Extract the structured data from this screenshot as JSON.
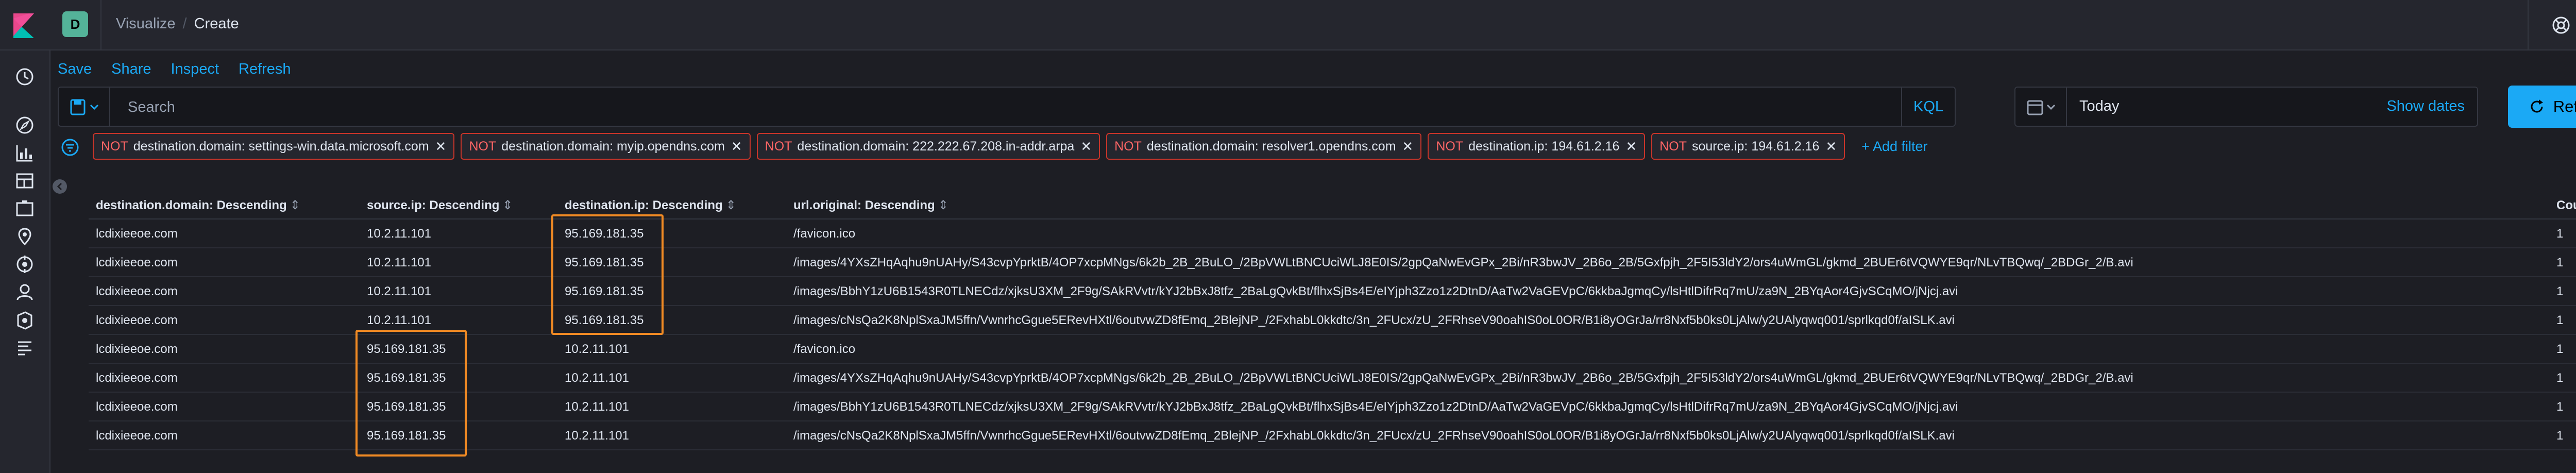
{
  "header": {
    "space_initial": "D",
    "breadcrumbs": [
      "Visualize",
      "Create"
    ]
  },
  "toolbar": {
    "save_label": "Save",
    "share_label": "Share",
    "inspect_label": "Inspect",
    "refresh_label": "Refresh"
  },
  "search": {
    "placeholder": "Search",
    "language_label": "KQL"
  },
  "time": {
    "value": "Today",
    "show_dates_label": "Show dates",
    "refresh_button_label": "Refresh"
  },
  "filters": {
    "items": [
      {
        "prefix": "NOT",
        "text": "destination.domain: settings-win.data.microsoft.com"
      },
      {
        "prefix": "NOT",
        "text": "destination.domain: myip.opendns.com"
      },
      {
        "prefix": "NOT",
        "text": "destination.domain: 222.222.67.208.in-addr.arpa"
      },
      {
        "prefix": "NOT",
        "text": "destination.domain: resolver1.opendns.com"
      },
      {
        "prefix": "NOT",
        "text": "destination.ip: 194.61.2.16"
      },
      {
        "prefix": "NOT",
        "text": "source.ip: 194.61.2.16"
      }
    ],
    "add_filter_label": "+ Add filter"
  },
  "table": {
    "columns": [
      "destination.domain: Descending",
      "source.ip: Descending",
      "destination.ip: Descending",
      "url.original: Descending",
      "Count"
    ],
    "rows": [
      [
        "lcdixieeoe.com",
        "10.2.11.101",
        "95.169.181.35",
        "/favicon.ico",
        "1"
      ],
      [
        "lcdixieeoe.com",
        "10.2.11.101",
        "95.169.181.35",
        "/images/4YXsZHqAqhu9nUAHy/S43cvpYprktB/4OP7xcpMNgs/6k2b_2B_2BuLO_/2BpVWLtBNCUciWLJ8E0IS/2gpQaNwEvGPx_2Bi/nR3bwJV_2B6o_2B/5Gxfpjh_2F5I53ldY2/ors4uWmGL/gkmd_2BUEr6tVQWYE9qr/NLvTBQwq/_2BDGr_2/B.avi",
        "1"
      ],
      [
        "lcdixieeoe.com",
        "10.2.11.101",
        "95.169.181.35",
        "/images/BbhY1zU6B1543R0TLNECdz/xjksU3XM_2F9g/SAkRVvtr/kYJ2bBxJ8tfz_2BaLgQvkBt/flhxSjBs4E/eIYjph3Zzo1z2DtnD/AaTw2VaGEVpC/6kkbaJgmqCy/lsHtlDifrRq7mU/za9N_2BYqAor4GjvSCqMO/jNjcj.avi",
        "1"
      ],
      [
        "lcdixieeoe.com",
        "10.2.11.101",
        "95.169.181.35",
        "/images/cNsQa2K8NplSxaJM5ffn/VwnrhcGgue5ERevHXtl/6outvwZD8fEmq_2BlejNP_/2FxhabL0kkdtc/3n_2FUcx/zU_2FRhseV90oahIS0oL0OR/B1i8yOGrJa/rr8Nxf5b0ks0LjAlw/y2UAlyqwq001/sprlkqd0f/aISLK.avi",
        "1"
      ],
      [
        "lcdixieeoe.com",
        "95.169.181.35",
        "10.2.11.101",
        "/favicon.ico",
        "1"
      ],
      [
        "lcdixieeoe.com",
        "95.169.181.35",
        "10.2.11.101",
        "/images/4YXsZHqAqhu9nUAHy/S43cvpYprktB/4OP7xcpMNgs/6k2b_2B_2BuLO_/2BpVWLtBNCUciWLJ8E0IS/2gpQaNwEvGPx_2Bi/nR3bwJV_2B6o_2B/5Gxfpjh_2F5I53ldY2/ors4uWmGL/gkmd_2BUEr6tVQWYE9qr/NLvTBQwq/_2BDGr_2/B.avi",
        "1"
      ],
      [
        "lcdixieeoe.com",
        "95.169.181.35",
        "10.2.11.101",
        "/images/BbhY1zU6B1543R0TLNECdz/xjksU3XM_2F9g/SAkRVvtr/kYJ2bBxJ8tfz_2BaLgQvkBt/flhxSjBs4E/eIYjph3Zzo1z2DtnD/AaTw2VaGEVpC/6kkbaJgmqCy/lsHtlDifrRq7mU/za9N_2BYqAor4GjvSCqMO/jNjcj.avi",
        "1"
      ],
      [
        "lcdixieeoe.com",
        "95.169.181.35",
        "10.2.11.101",
        "/images/cNsQa2K8NplSxaJM5ffn/VwnrhcGgue5ERevHXtl/6outvwZD8fEmq_2BlejNP_/2FxhabL0kkdtc/3n_2FUcx/zU_2FRhseV90oahIS0oL0OR/B1i8yOGrJa/rr8Nxf5b0ks0LjAlw/y2UAlyqwq001/sprlkqd0f/aISLK.avi",
        "1"
      ]
    ]
  },
  "sidenav_icons": [
    "clock-icon",
    "compass-icon",
    "bar-chart-icon",
    "dashboard-icon",
    "canvas-icon",
    "maps-icon",
    "ml-icon",
    "user-icon",
    "apm-icon",
    "logs-icon"
  ],
  "colors": {
    "accent": "#1ba9f5",
    "filter_border": "#c8352a",
    "highlight": "#f08a24",
    "space_badge": "#54b399"
  }
}
